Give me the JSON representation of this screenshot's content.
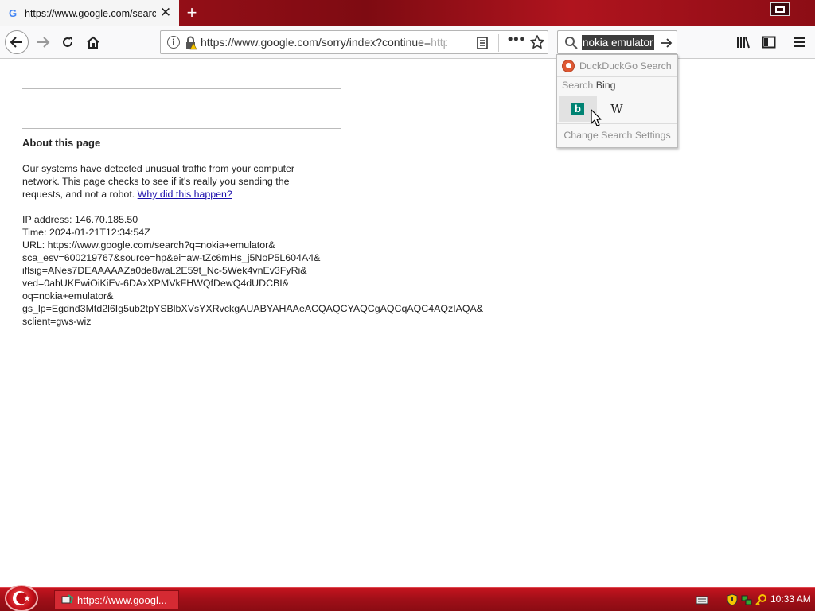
{
  "browser": {
    "tab": {
      "favicon": "G",
      "title": "https://www.google.com/search",
      "close_glyph": "✕"
    },
    "new_tab_glyph": "+",
    "urlbar": {
      "url_main": "https://www.google.com/sorry/index?continue=",
      "url_faded": "https://www.google.com/search"
    },
    "page_actions_glyph": "•••",
    "searchbar": {
      "value": "nokia emulator"
    }
  },
  "search_popup": {
    "one_off_label": "DuckDuckGo Search",
    "search_with_prefix": "Search",
    "search_with_engine": "Bing",
    "engines": [
      {
        "name": "Bing",
        "glyph": "b"
      },
      {
        "name": "Wikipedia",
        "glyph": "W"
      }
    ],
    "change_settings_label": "Change Search Settings"
  },
  "page": {
    "about_title": "About this page",
    "paragraph": "Our systems have detected unusual traffic from your computer network. This page checks to see if it's really you sending the requests, and not a robot.",
    "why_link": "Why did this happen?",
    "info_lines": [
      "IP address: 146.70.185.50",
      "Time: 2024-01-21T12:34:54Z",
      "URL: https://www.google.com/search?q=nokia+emulator&",
      "sca_esv=600219767&source=hp&ei=aw-tZc6mHs_j5NoP5L604A4&",
      "iflsig=ANes7DEAAAAAZa0de8waL2E59t_Nc-5Wek4vnEv3FyRi&",
      "ved=0ahUKEwiOiKiEv-6DAxXPMVkFHWQfDewQ4dUDCBI&",
      "oq=nokia+emulator&",
      "gs_lp=Egdnd3Mtd2l6Ig5ub2tpYSBlbXVsYXRvckgAUABYAHAAeACQAQCYAQCgAQCqAQC4AQzIAQA&",
      "sclient=gws-wiz"
    ]
  },
  "taskbar": {
    "task_label": "https://www.googl...",
    "clock": "10:33 AM"
  },
  "colors": {
    "accent_red": "#a8121c",
    "link_blue": "#1a0dab",
    "bing_teal": "#008373",
    "ddg_orange": "#de5833"
  }
}
